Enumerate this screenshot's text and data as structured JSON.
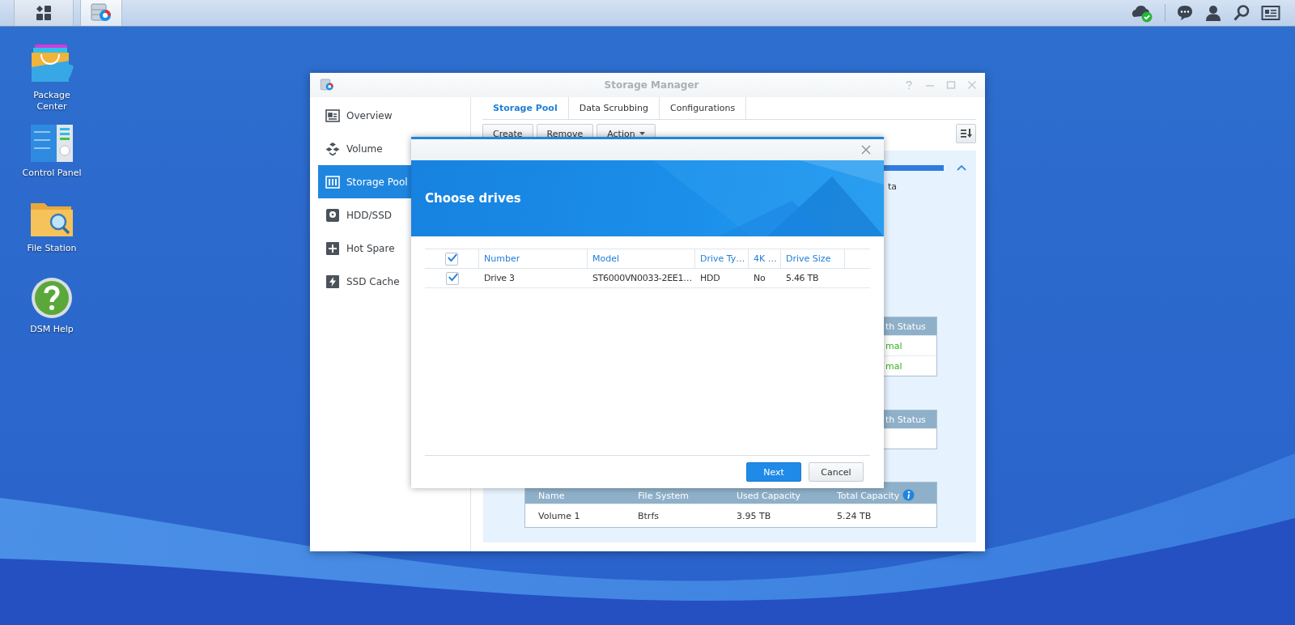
{
  "taskbar": {
    "buttons": [
      {
        "kind": "main-menu",
        "selected": false
      },
      {
        "kind": "storage-manager",
        "selected": true
      }
    ],
    "tray": [
      {
        "kind": "cloud-check"
      },
      {
        "kind": "chat"
      },
      {
        "kind": "user"
      },
      {
        "kind": "search"
      },
      {
        "kind": "card"
      }
    ]
  },
  "desktop_icons": [
    {
      "kind": "package",
      "label": "Package Center"
    },
    {
      "kind": "control",
      "label": "Control Panel"
    },
    {
      "kind": "folder",
      "label": "File Station"
    },
    {
      "kind": "help",
      "label": "DSM Help"
    }
  ],
  "window": {
    "title": "Storage Manager",
    "sidebar": [
      {
        "kind": "overview",
        "label": "Overview",
        "selected": false
      },
      {
        "kind": "volume",
        "label": "Volume",
        "selected": false
      },
      {
        "kind": "pool",
        "label": "Storage Pool",
        "selected": true
      },
      {
        "kind": "hdd",
        "label": "HDD/SSD",
        "selected": false
      },
      {
        "kind": "spare",
        "label": "Hot Spare",
        "selected": false
      },
      {
        "kind": "cache",
        "label": "SSD Cache",
        "selected": false
      }
    ],
    "tabs": [
      {
        "label": "Storage Pool",
        "selected": true
      },
      {
        "label": "Data Scrubbing",
        "selected": false
      },
      {
        "label": "Configurations",
        "selected": false
      }
    ],
    "toolbar": [
      {
        "label": "Create",
        "dropdown": false
      },
      {
        "label": "Remove",
        "dropdown": false
      },
      {
        "label": "Action",
        "dropdown": true
      }
    ],
    "panel": {
      "text_fragment": "ta",
      "drive_table": {
        "header": "th Status",
        "rows": [
          {
            "status": "mal"
          },
          {
            "status": "mal"
          }
        ]
      },
      "spare_table": {
        "header": "th Status"
      },
      "volume_table": {
        "columns": [
          "Name",
          "File System",
          "Used Capacity",
          "Total Capacity"
        ],
        "rows": [
          [
            "Volume 1",
            "Btrfs",
            "3.95 TB",
            "5.24 TB"
          ]
        ]
      }
    }
  },
  "dialog": {
    "title": "Choose drives",
    "select_all_checked": true,
    "columns": [
      "Number",
      "Model",
      "Drive Ty…",
      "4K …",
      "Drive Size"
    ],
    "rows": [
      {
        "checked": true,
        "cells": [
          "Drive 3",
          "ST6000VN0033-2EE1…",
          "HDD",
          "No",
          "5.46 TB"
        ]
      }
    ],
    "buttons": [
      {
        "label": "Next",
        "primary": true
      },
      {
        "label": "Cancel",
        "primary": false
      }
    ]
  }
}
